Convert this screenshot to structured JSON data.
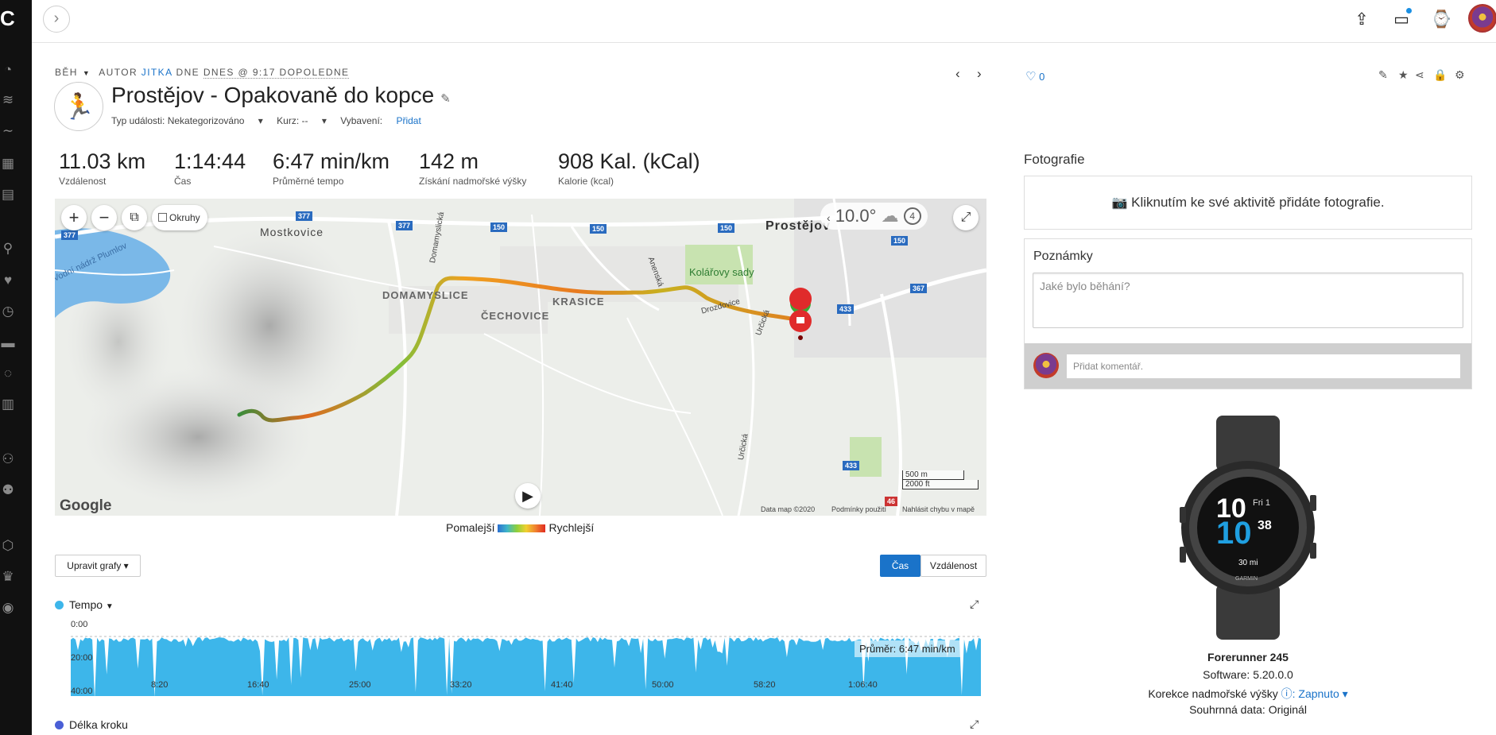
{
  "sidebar": {
    "logo": "C",
    "icons": [
      "dashboard-icon",
      "layers-icon",
      "trends-icon",
      "calendar-icon",
      "reports-icon",
      "activities-icon",
      "health-icon",
      "stopwatch-icon",
      "shoe-icon",
      "insights-icon",
      "stats-icon",
      "connections-icon",
      "groups-icon",
      "badges-icon",
      "trophy-icon",
      "target-icon"
    ]
  },
  "topbar": {
    "icons": [
      "upload-icon",
      "inbox-icon",
      "watch-icon"
    ]
  },
  "activity": {
    "breadcrumb": {
      "type": "BĚH",
      "author_prefix": "AUTOR",
      "author": "JITKA",
      "date_prefix": "DNE",
      "date": "DNES @ 9:17 DOPOLEDNE"
    },
    "title": "Prostějov - Opakovaně do kopce",
    "meta": {
      "event_type": "Typ události: Nekategorizováno",
      "course": "Kurz: --",
      "gear_label": "Vybavení:",
      "gear_link": "Přidat"
    },
    "stats": [
      {
        "value": "11.03 km",
        "label": "Vzdálenost"
      },
      {
        "value": "1:14:44",
        "label": "Čas"
      },
      {
        "value": "6:47 min/km",
        "label": "Průměrné tempo"
      },
      {
        "value": "142 m",
        "label": "Získání nadmořské výšky"
      },
      {
        "value": "908 Kal. (kCal)",
        "label": "Kalorie (kcal)"
      }
    ]
  },
  "map": {
    "zoom_in": "+",
    "zoom_out": "−",
    "laps_label": "Okruhy",
    "temperature": "10.0°",
    "wind": "4",
    "places": [
      {
        "name": "Mostkovice"
      },
      {
        "name": "Prostějov"
      },
      {
        "name": "DOMAMYSLICE"
      },
      {
        "name": "ČECHOVICE"
      },
      {
        "name": "KRASICE"
      },
      {
        "name": "Kolářovy sady"
      },
      {
        "name": "Vodní nádrž Plumlov"
      },
      {
        "name": "Domamyslická"
      },
      {
        "name": "Anenská"
      },
      {
        "name": "Drozdovice"
      },
      {
        "name": "Určická"
      },
      {
        "name": "Určická"
      }
    ],
    "roads": [
      "377",
      "377",
      "377",
      "150",
      "150",
      "150",
      "150",
      "433",
      "367",
      "433",
      "46"
    ],
    "scale_m": "500 m",
    "scale_ft": "2000 ft",
    "google": "Google",
    "footer": {
      "data": "Data map ©2020",
      "terms": "Podmínky použití",
      "report": "Nahlásit chybu v mapě"
    }
  },
  "legend": {
    "slower": "Pomalejší",
    "faster": "Rychlejší"
  },
  "charts": {
    "edit_button": "Upravit grafy ▾",
    "toggle": {
      "time": "Čas",
      "distance": "Vzdálenost"
    },
    "pace": {
      "title": "Tempo",
      "color": "#3db6ea",
      "y_ticks": [
        "0:00",
        "20:00",
        "40:00"
      ],
      "x_ticks": [
        "8:20",
        "16:40",
        "25:00",
        "33:20",
        "41:40",
        "50:00",
        "58:20",
        "1:06:40"
      ],
      "average": "Průměr: 6:47 min/km"
    },
    "stride": {
      "title": "Délka kroku",
      "color": "#4a5fd6"
    }
  },
  "right": {
    "likes": "0",
    "photos_title": "Fotografie",
    "photos_prompt": "Kliknutím ke své aktivitě přidáte fotografie.",
    "notes_title": "Poznámky",
    "notes_placeholder": "Jaké bylo běhání?",
    "comment_placeholder": "Přidat komentář.",
    "device": {
      "name": "Forerunner 245",
      "software": "Software: 5.20.0.0",
      "elevation_label": "Korekce nadmořské výšky",
      "elevation_value": ": Zapnuto ▾",
      "summary": "Souhrnná data: Originál",
      "watch_face": {
        "hour": "10",
        "day": "Fri 1",
        "min": "10",
        "sec": "38",
        "distance": "30 mi",
        "brand": "GARMIN"
      }
    }
  }
}
